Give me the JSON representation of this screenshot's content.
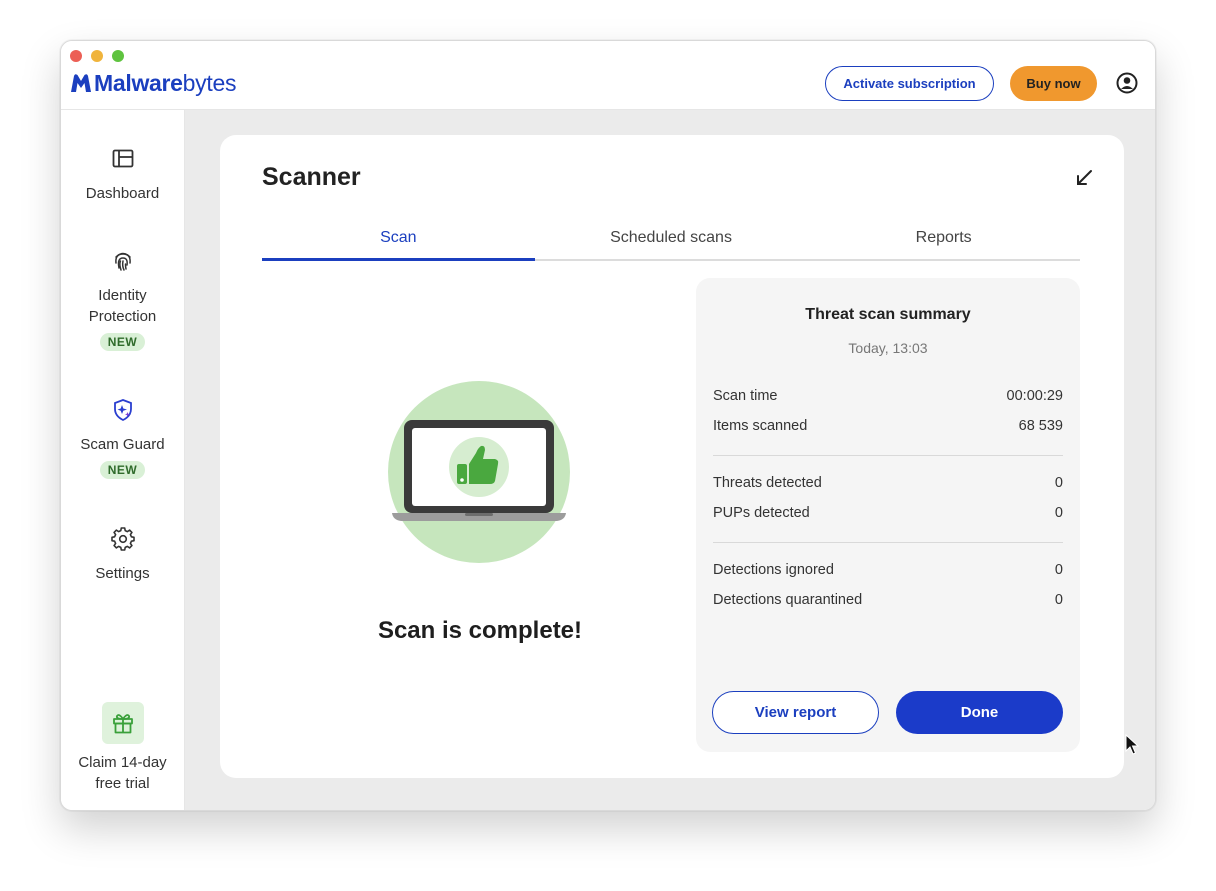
{
  "app": {
    "logo_text_bold": "Malware",
    "logo_text_light": "bytes",
    "brand_color": "#1b3fbf"
  },
  "header": {
    "activate_label": "Activate subscription",
    "buy_label": "Buy now",
    "account_icon": "account-circle-icon"
  },
  "sidebar": {
    "items": [
      {
        "label": "Dashboard",
        "icon": "dashboard-icon"
      },
      {
        "label": "Identity\nProtection",
        "icon": "fingerprint-icon",
        "badge": "NEW"
      },
      {
        "label": "Scam Guard",
        "icon": "shield-sparkle-icon",
        "badge": "NEW"
      },
      {
        "label": "Settings",
        "icon": "gear-icon"
      }
    ],
    "trial": {
      "label": "Claim 14-day free trial",
      "icon": "gift-icon"
    }
  },
  "scanner": {
    "title": "Scanner",
    "tabs": [
      "Scan",
      "Scheduled scans",
      "Reports"
    ],
    "active_tab": 0,
    "status_text": "Scan is complete!"
  },
  "summary": {
    "title": "Threat scan summary",
    "date": "Today, 13:03",
    "rows": [
      {
        "label": "Scan time",
        "value": "00:00:29"
      },
      {
        "label": "Items scanned",
        "value": "68 539"
      },
      {
        "label": "Threats detected",
        "value": "0"
      },
      {
        "label": "PUPs detected",
        "value": "0"
      },
      {
        "label": "Detections ignored",
        "value": "0"
      },
      {
        "label": "Detections quarantined",
        "value": "0"
      }
    ],
    "view_report_label": "View report",
    "done_label": "Done"
  }
}
